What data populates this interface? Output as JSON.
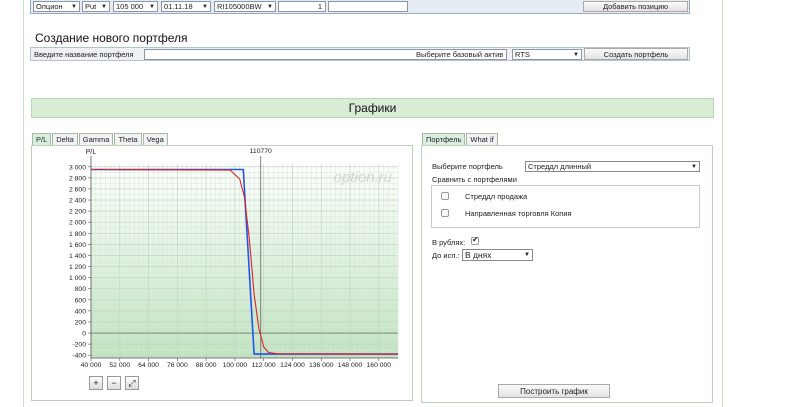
{
  "position_row": {
    "type_value": "Опцион",
    "kind_value": "Put",
    "strike_value": "105 000",
    "date_value": "01.11.18",
    "ticker_value": "RI105000BW",
    "qty_value": "1",
    "add_button": "Добавить позицию"
  },
  "create_portfolio": {
    "title": "Создание нового портфеля",
    "name_label": "Введите название портфеля",
    "asset_label": "Выберите базовый актив",
    "asset_value": "RTS",
    "create_button": "Создать портфель"
  },
  "section_title": "Графики",
  "chart_tabs": [
    "P/L",
    "Delta",
    "Gamma",
    "Theta",
    "Vega"
  ],
  "right_tabs": [
    "Портфель",
    "What if"
  ],
  "chart_data": {
    "type": "line",
    "ylabel": "P/L",
    "watermark": "option.ru",
    "marker_label": "110770",
    "marker_x": 110770,
    "xlim": [
      40000,
      168000
    ],
    "ylim": [
      -450,
      3050
    ],
    "x_ticks": [
      40000,
      52000,
      64000,
      76000,
      88000,
      100000,
      112000,
      124000,
      136000,
      148000,
      160000
    ],
    "x_tick_labels": [
      "40 000",
      "52 000",
      "64 000",
      "76 000",
      "88 000",
      "100 000",
      "112 000",
      "124 000",
      "136 000",
      "148 000",
      "160 000"
    ],
    "y_ticks": [
      -400,
      -200,
      0,
      200,
      400,
      600,
      800,
      1000,
      1200,
      1400,
      1600,
      1800,
      2000,
      2200,
      2400,
      2600,
      2800,
      3000
    ],
    "y_tick_labels": [
      "-400",
      "-200",
      "0",
      "200",
      "400",
      "600",
      "800",
      "1 000",
      "1 200",
      "1 400",
      "1 600",
      "1 800",
      "2 000",
      "2 200",
      "2 400",
      "2 600",
      "2 800",
      "3 000"
    ],
    "grid": true,
    "series": [
      {
        "color": "#2255ee",
        "x": [
          40000,
          103500,
          108000,
          168000
        ],
        "y": [
          2950,
          2950,
          -380,
          -380
        ]
      },
      {
        "color": "#dd2222",
        "x": [
          40000,
          98000,
          102000,
          104000,
          106000,
          108000,
          110000,
          112000,
          114000,
          118000,
          168000
        ],
        "y": [
          2950,
          2940,
          2780,
          2450,
          1700,
          700,
          80,
          -250,
          -350,
          -375,
          -380
        ]
      }
    ]
  },
  "zoom_buttons": [
    "+",
    "−",
    "⤢"
  ],
  "right_panel": {
    "select_portfolio_label": "Выберите портфель",
    "portfolio_value": "Стреддл длинный",
    "compare_label": "Сравнить с портфелями",
    "compare_items": [
      "Стреддл продажа",
      "Направленная торговля Копия"
    ],
    "rub_label": "В рублях:",
    "rub_checked": true,
    "expiry_label": "До исп.:",
    "expiry_value": "В днях",
    "build_button": "Построить график"
  }
}
